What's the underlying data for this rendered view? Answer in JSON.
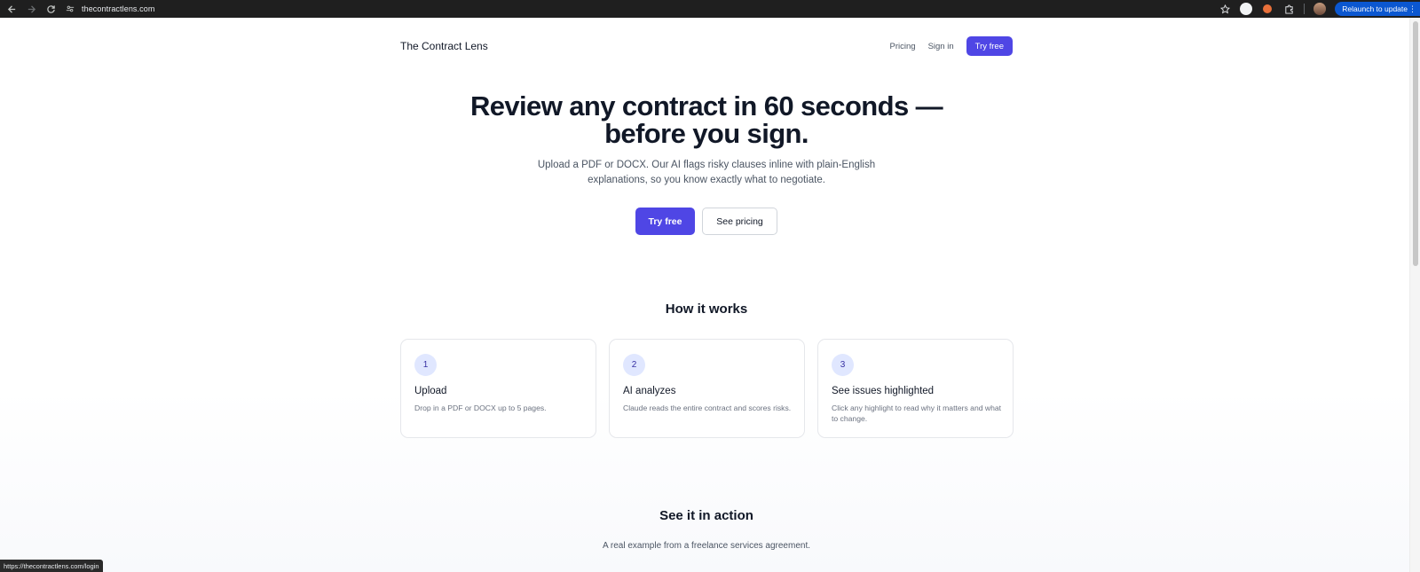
{
  "browser": {
    "url": "thecontractlens.com",
    "relaunch_label": "Relaunch to update",
    "status_link": "https://thecontractlens.com/login"
  },
  "nav": {
    "brand": "The Contract Lens",
    "pricing": "Pricing",
    "signin": "Sign in",
    "try_free": "Try free"
  },
  "hero": {
    "title_line1": "Review any contract in 60 seconds —",
    "title_line2": "before you sign.",
    "subtitle_line1": "Upload a PDF or DOCX. Our AI flags risky clauses inline with plain-English",
    "subtitle_line2": "explanations, so you know exactly what to negotiate.",
    "cta_primary": "Try free",
    "cta_secondary": "See pricing"
  },
  "how_it_works": {
    "title": "How it works",
    "steps": [
      {
        "num": "1",
        "title": "Upload",
        "desc": "Drop in a PDF or DOCX up to 5 pages."
      },
      {
        "num": "2",
        "title": "AI analyzes",
        "desc": "Claude reads the entire contract and scores risks."
      },
      {
        "num": "3",
        "title": "See issues highlighted",
        "desc": "Click any highlight to read why it matters and what to change."
      }
    ]
  },
  "see_it": {
    "title": "See it in action",
    "subtitle": "A real example from a freelance services agreement."
  },
  "colors": {
    "accent": "#4f46e5",
    "chrome_bg": "#1f1f1f",
    "relaunch_bg": "#0b57d0",
    "step_badge_bg": "#e0e7ff"
  }
}
